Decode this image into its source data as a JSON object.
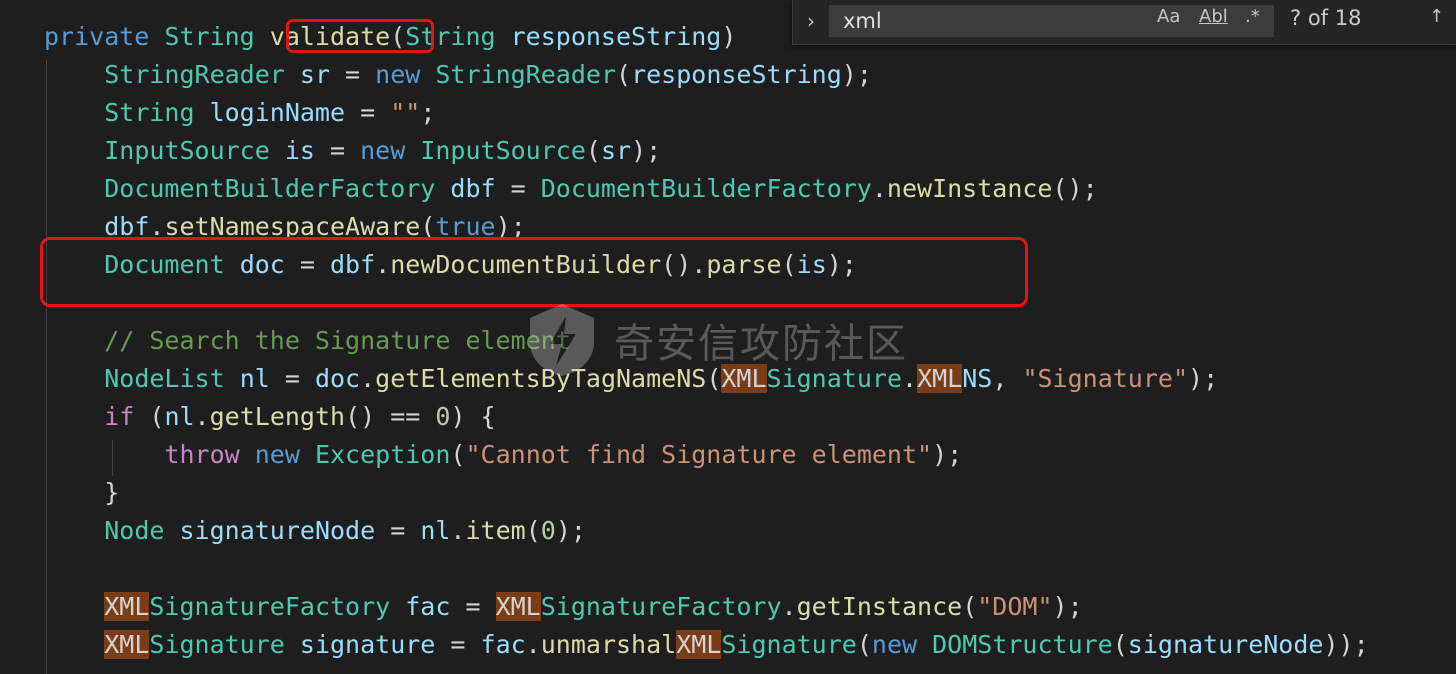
{
  "find_widget": {
    "toggle_icon": "chevron-right-icon",
    "query": "xml",
    "match_case_label": "Aa",
    "whole_word_label": "Abl",
    "regex_label": ".*",
    "match_count": "? of 18"
  },
  "watermark": {
    "text": "奇安信攻防社区"
  },
  "code": {
    "lines": [
      [
        [
          "kw",
          "private "
        ],
        [
          "ty",
          "String "
        ],
        [
          "fn",
          "validate"
        ],
        [
          "pu",
          "("
        ],
        [
          "ty",
          "String "
        ],
        [
          "va",
          "responseString"
        ],
        [
          "pu",
          ")"
        ]
      ],
      [
        [
          "pu",
          "    "
        ],
        [
          "ty",
          "StringReader "
        ],
        [
          "va",
          "sr"
        ],
        [
          "pu",
          " = "
        ],
        [
          "kw",
          "new "
        ],
        [
          "ty",
          "StringReader"
        ],
        [
          "pu",
          "("
        ],
        [
          "va",
          "responseString"
        ],
        [
          "pu",
          ");"
        ]
      ],
      [
        [
          "pu",
          "    "
        ],
        [
          "ty",
          "String "
        ],
        [
          "va",
          "loginName"
        ],
        [
          "pu",
          " = "
        ],
        [
          "st",
          "\"\""
        ],
        [
          "pu",
          ";"
        ]
      ],
      [
        [
          "pu",
          "    "
        ],
        [
          "ty",
          "InputSource "
        ],
        [
          "va",
          "is"
        ],
        [
          "pu",
          " = "
        ],
        [
          "kw",
          "new "
        ],
        [
          "ty",
          "InputSource"
        ],
        [
          "pu",
          "("
        ],
        [
          "va",
          "sr"
        ],
        [
          "pu",
          ");"
        ]
      ],
      [
        [
          "pu",
          "    "
        ],
        [
          "ty",
          "DocumentBuilderFactory "
        ],
        [
          "va",
          "dbf"
        ],
        [
          "pu",
          " = "
        ],
        [
          "ty",
          "DocumentBuilderFactory"
        ],
        [
          "pu",
          "."
        ],
        [
          "fn",
          "newInstance"
        ],
        [
          "pu",
          "();"
        ]
      ],
      [
        [
          "pu",
          "    "
        ],
        [
          "va",
          "dbf"
        ],
        [
          "pu",
          "."
        ],
        [
          "fn",
          "setNamespaceAware"
        ],
        [
          "pu",
          "("
        ],
        [
          "kw",
          "true"
        ],
        [
          "pu",
          ");"
        ]
      ],
      [
        [
          "pu",
          "    "
        ],
        [
          "ty",
          "Document "
        ],
        [
          "va",
          "doc"
        ],
        [
          "pu",
          " = "
        ],
        [
          "va",
          "dbf"
        ],
        [
          "pu",
          "."
        ],
        [
          "fn",
          "newDocumentBuilder"
        ],
        [
          "pu",
          "()."
        ],
        [
          "fn",
          "parse"
        ],
        [
          "pu",
          "("
        ],
        [
          "va",
          "is"
        ],
        [
          "pu",
          ");"
        ]
      ],
      [],
      [
        [
          "pu",
          "    "
        ],
        [
          "cm",
          "// Search the Signature element"
        ]
      ],
      [
        [
          "pu",
          "    "
        ],
        [
          "ty",
          "NodeList "
        ],
        [
          "va",
          "nl"
        ],
        [
          "pu",
          " = "
        ],
        [
          "va",
          "doc"
        ],
        [
          "pu",
          "."
        ],
        [
          "fn",
          "getElementsByTagNameNS"
        ],
        [
          "pu",
          "("
        ],
        [
          "hl",
          "XML"
        ],
        [
          "ty",
          "Signature"
        ],
        [
          "pu",
          "."
        ],
        [
          "hl",
          "XML"
        ],
        [
          "va",
          "NS"
        ],
        [
          "pu",
          ", "
        ],
        [
          "st",
          "\"Signature\""
        ],
        [
          "pu",
          ");"
        ]
      ],
      [
        [
          "pu",
          "    "
        ],
        [
          "kw2",
          "if "
        ],
        [
          "pu",
          "("
        ],
        [
          "va",
          "nl"
        ],
        [
          "pu",
          "."
        ],
        [
          "fn",
          "getLength"
        ],
        [
          "pu",
          "() == "
        ],
        [
          "nu",
          "0"
        ],
        [
          "pu",
          ") {"
        ]
      ],
      [
        [
          "pu",
          "        "
        ],
        [
          "kw2",
          "throw "
        ],
        [
          "kw",
          "new "
        ],
        [
          "ty",
          "Exception"
        ],
        [
          "pu",
          "("
        ],
        [
          "st",
          "\"Cannot find Signature element\""
        ],
        [
          "pu",
          ");"
        ]
      ],
      [
        [
          "pu",
          "    }"
        ]
      ],
      [
        [
          "pu",
          "    "
        ],
        [
          "ty",
          "Node "
        ],
        [
          "va",
          "signatureNode"
        ],
        [
          "pu",
          " = "
        ],
        [
          "va",
          "nl"
        ],
        [
          "pu",
          "."
        ],
        [
          "fn",
          "item"
        ],
        [
          "pu",
          "("
        ],
        [
          "nu",
          "0"
        ],
        [
          "pu",
          ");"
        ]
      ],
      [],
      [
        [
          "pu",
          "    "
        ],
        [
          "hl",
          "XML"
        ],
        [
          "ty",
          "SignatureFactory "
        ],
        [
          "va",
          "fac"
        ],
        [
          "pu",
          " = "
        ],
        [
          "hl",
          "XML"
        ],
        [
          "ty",
          "SignatureFactory"
        ],
        [
          "pu",
          "."
        ],
        [
          "fn",
          "getInstance"
        ],
        [
          "pu",
          "("
        ],
        [
          "st",
          "\"DOM\""
        ],
        [
          "pu",
          ");"
        ]
      ],
      [
        [
          "pu",
          "    "
        ],
        [
          "hl",
          "XML"
        ],
        [
          "ty",
          "Signature "
        ],
        [
          "va",
          "signature"
        ],
        [
          "pu",
          " = "
        ],
        [
          "va",
          "fac"
        ],
        [
          "pu",
          "."
        ],
        [
          "fn",
          "unmarshal"
        ],
        [
          "hl",
          "XML"
        ],
        [
          "ty",
          "Signature"
        ],
        [
          "pu",
          "("
        ],
        [
          "kw",
          "new "
        ],
        [
          "ty",
          "DOMStructure"
        ],
        [
          "pu",
          "("
        ],
        [
          "va",
          "signatureNode"
        ],
        [
          "pu",
          "));"
        ]
      ]
    ]
  }
}
